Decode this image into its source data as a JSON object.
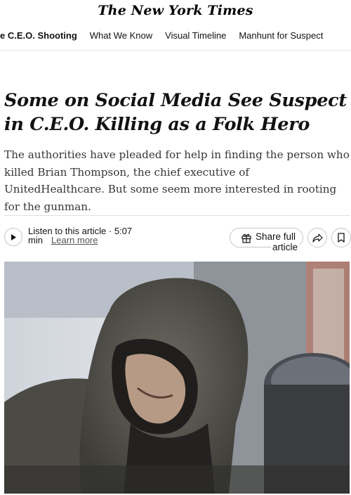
{
  "masthead": {
    "logo_text": "The New York Times"
  },
  "nav": {
    "items": [
      "e C.E.O. Shooting",
      "What We Know",
      "Visual Timeline",
      "Manhunt for Suspect"
    ]
  },
  "article": {
    "headline": "Some on Social Media See Suspect in C.E.O. Killing as a Folk Hero",
    "summary": "The authorities have pleaded for help in finding the person who killed Brian Thompson, the chief executive of UnitedHealthcare. But some seem more interested in rooting for the gunman."
  },
  "toolbar": {
    "listen_label": "Listen to this article · 5:07",
    "listen_unit": "min",
    "learn_more": "Learn more",
    "share_label_1": "Share full",
    "share_label_2": "article"
  },
  "icons": {
    "play": "play-icon",
    "gift": "gift-icon",
    "share": "share-arrow-icon",
    "bookmark": "bookmark-icon"
  },
  "colors": {
    "text": "#121212",
    "summary": "#363636",
    "border": "#c7c7c7"
  }
}
